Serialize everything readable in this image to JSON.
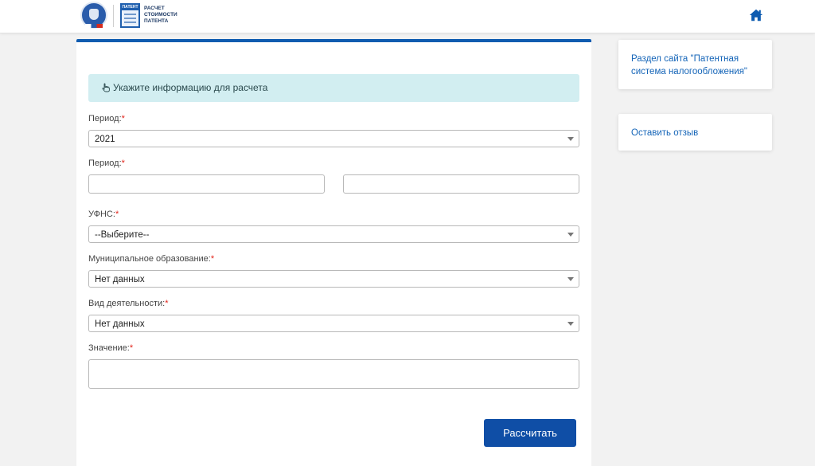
{
  "header": {
    "logo_text": "РАСЧЕТ СТОИМОСТИ ПАТЕНТА",
    "patent_icon_label": "ПАТЕНТ",
    "home_icon": "home-icon",
    "accent_color": "#0f5cb0"
  },
  "form": {
    "info_text": "Укажите информацию для расчета",
    "info_icon": "hand-pointer-icon",
    "fields": {
      "period_select": {
        "label": "Период:",
        "value": "2021"
      },
      "period_range": {
        "label": "Период:",
        "from_value": "",
        "to_value": ""
      },
      "ufns": {
        "label": "УФНС:",
        "value": "--Выберите--"
      },
      "municipality": {
        "label": "Муниципальное образование:",
        "value": "Нет данных"
      },
      "activity": {
        "label": "Вид деятельности:",
        "value": "Нет данных"
      },
      "value": {
        "label": "Значение:",
        "value": ""
      }
    },
    "required_mark": "*",
    "submit_label": "Рассчитать"
  },
  "sidebar": {
    "links": [
      {
        "label": "Раздел сайта \"Патентная система налогообложения\""
      },
      {
        "label": "Оставить отзыв"
      }
    ]
  }
}
